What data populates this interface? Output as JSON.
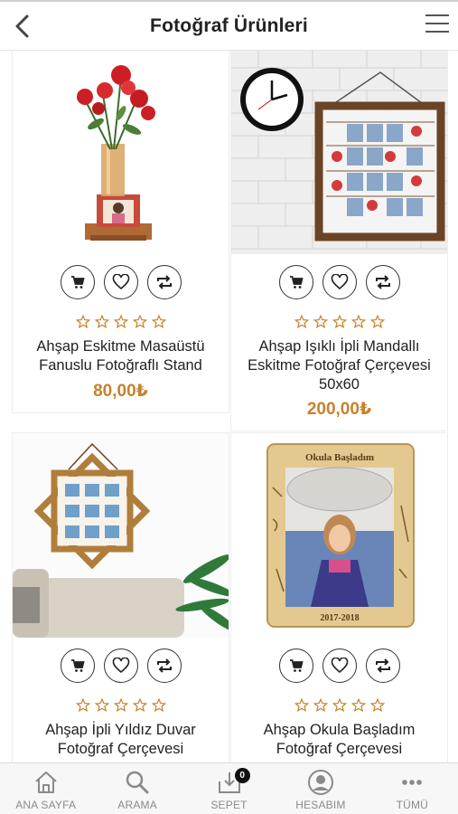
{
  "header": {
    "title": "Fotoğraf Ürünleri",
    "back_icon": "chevron-left-icon",
    "menu_icon": "hamburger-menu-icon"
  },
  "colors": {
    "price": "#c8812c",
    "star": "#c8812c",
    "tab_label": "#8a8a8a"
  },
  "products": [
    {
      "name": "Ahşap Eskitme Masaüstü Fanuslu Fotoğraflı Stand",
      "price": "80,00₺",
      "rating": 0
    },
    {
      "name": "Ahşap Işıklı İpli Mandallı Eskitme Fotoğraf Çerçevesi 50x60",
      "price": "200,00₺",
      "rating": 0
    },
    {
      "name": "Ahşap İpli Yıldız Duvar Fotoğraf Çerçevesi",
      "price": "",
      "rating": 0
    },
    {
      "name": "Ahşap Okula Başladım Fotoğraf Çerçevesi",
      "price": "",
      "rating": 0
    }
  ],
  "product_images": {
    "frame_text_top": "Okula Başladım",
    "frame_text_bottom": "2017-2018"
  },
  "tabbar": {
    "items": [
      {
        "label": "ANA SAYFA",
        "icon": "home-icon"
      },
      {
        "label": "ARAMA",
        "icon": "search-icon"
      },
      {
        "label": "SEPET",
        "icon": "cart-icon",
        "badge": "0"
      },
      {
        "label": "HESABIM",
        "icon": "user-icon"
      },
      {
        "label": "TÜMÜ",
        "icon": "more-icon"
      }
    ]
  }
}
